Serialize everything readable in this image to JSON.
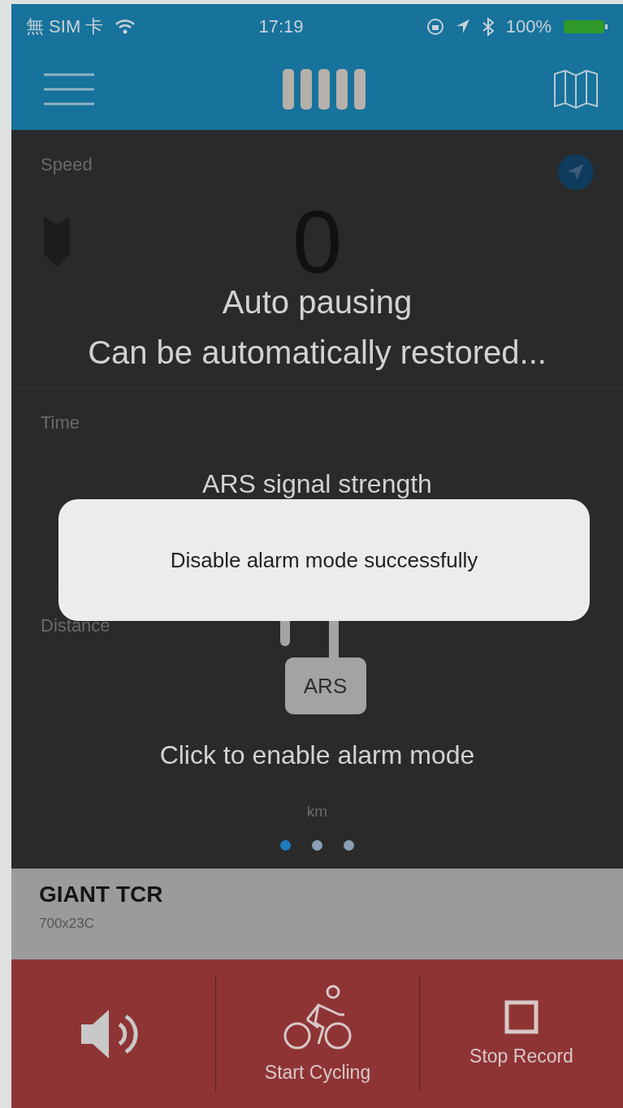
{
  "status_bar": {
    "carrier": "無 SIM 卡",
    "time": "17:19",
    "battery": "100%"
  },
  "dashboard": {
    "speed": {
      "label": "Speed",
      "value": "0"
    },
    "time": {
      "label": "Time"
    },
    "distance": {
      "label": "Distance",
      "unit": "km"
    },
    "pager": [
      {
        "selected": true
      },
      {
        "selected": false
      },
      {
        "selected": false
      }
    ]
  },
  "overlay": {
    "title": "Auto pausing",
    "subtitle": "Can be automatically restored...",
    "signal_label": "ARS signal strength",
    "lock_label": "ARS",
    "lock_hint": "Click to enable alarm mode"
  },
  "toast": "Disable alarm mode successfully",
  "bike": {
    "name": "GIANT TCR",
    "tire": "700x23C"
  },
  "actions": [
    {
      "kind": "sound"
    },
    {
      "kind": "cycle",
      "label": "Start Cycling"
    },
    {
      "kind": "stop",
      "label": "Stop Record"
    }
  ]
}
